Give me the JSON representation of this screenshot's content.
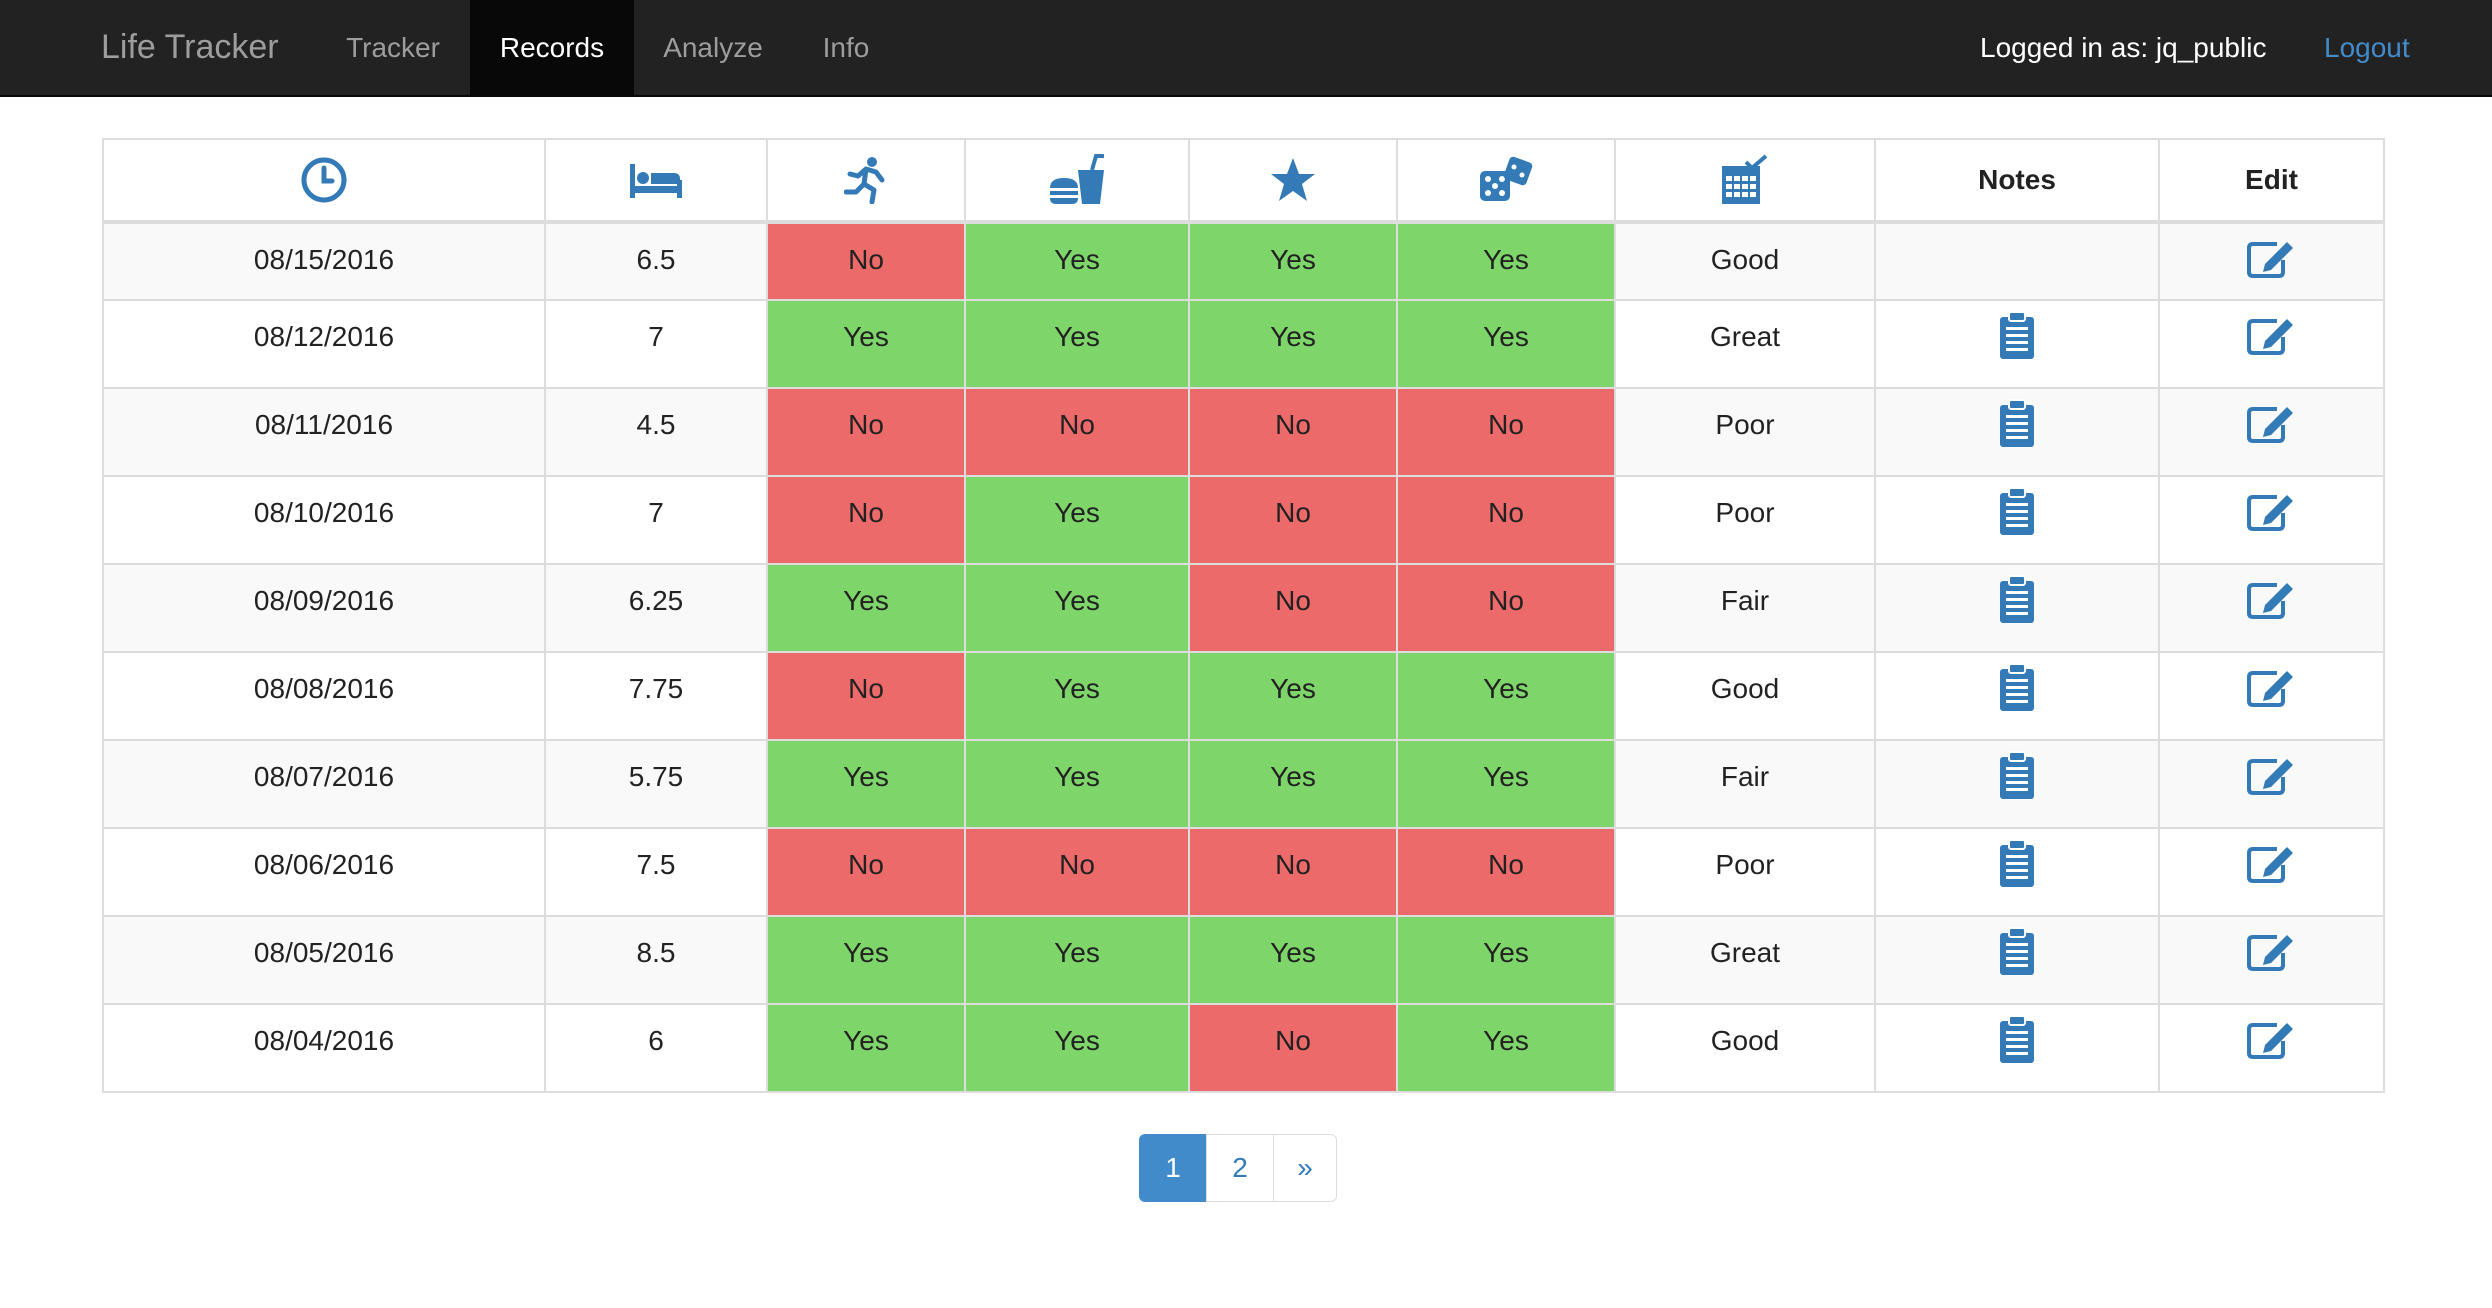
{
  "navbar": {
    "brand": "Life Tracker",
    "items": [
      {
        "label": "Tracker"
      },
      {
        "label": "Records"
      },
      {
        "label": "Analyze"
      },
      {
        "label": "Info"
      }
    ],
    "active": "Records",
    "logged_in": "Logged in as: jq_public",
    "logout": "Logout"
  },
  "table": {
    "header_icons": [
      "clock-icon",
      "bed-icon",
      "running-icon",
      "food-drink-icon",
      "star-icon",
      "dice-icon",
      "calendar-check-icon"
    ],
    "headers": {
      "notes": "Notes",
      "edit": "Edit"
    },
    "rows": [
      {
        "date": "08/15/2016",
        "sleep": "6.5",
        "exercise": "No",
        "diet": "Yes",
        "goal": "Yes",
        "fun": "Yes",
        "day": "Good",
        "has_notes": false
      },
      {
        "date": "08/12/2016",
        "sleep": "7",
        "exercise": "Yes",
        "diet": "Yes",
        "goal": "Yes",
        "fun": "Yes",
        "day": "Great",
        "has_notes": true
      },
      {
        "date": "08/11/2016",
        "sleep": "4.5",
        "exercise": "No",
        "diet": "No",
        "goal": "No",
        "fun": "No",
        "day": "Poor",
        "has_notes": true
      },
      {
        "date": "08/10/2016",
        "sleep": "7",
        "exercise": "No",
        "diet": "Yes",
        "goal": "No",
        "fun": "No",
        "day": "Poor",
        "has_notes": true
      },
      {
        "date": "08/09/2016",
        "sleep": "6.25",
        "exercise": "Yes",
        "diet": "Yes",
        "goal": "No",
        "fun": "No",
        "day": "Fair",
        "has_notes": true
      },
      {
        "date": "08/08/2016",
        "sleep": "7.75",
        "exercise": "No",
        "diet": "Yes",
        "goal": "Yes",
        "fun": "Yes",
        "day": "Good",
        "has_notes": true
      },
      {
        "date": "08/07/2016",
        "sleep": "5.75",
        "exercise": "Yes",
        "diet": "Yes",
        "goal": "Yes",
        "fun": "Yes",
        "day": "Fair",
        "has_notes": true
      },
      {
        "date": "08/06/2016",
        "sleep": "7.5",
        "exercise": "No",
        "diet": "No",
        "goal": "No",
        "fun": "No",
        "day": "Poor",
        "has_notes": true
      },
      {
        "date": "08/05/2016",
        "sleep": "8.5",
        "exercise": "Yes",
        "diet": "Yes",
        "goal": "Yes",
        "fun": "Yes",
        "day": "Great",
        "has_notes": true
      },
      {
        "date": "08/04/2016",
        "sleep": "6",
        "exercise": "Yes",
        "diet": "Yes",
        "goal": "No",
        "fun": "Yes",
        "day": "Good",
        "has_notes": true
      }
    ]
  },
  "pagination": {
    "pages": [
      "1",
      "2"
    ],
    "next": "»",
    "current": "1"
  },
  "colors": {
    "yes": "#7ed56a",
    "no": "#ec6a6a",
    "icon": "#337ab7",
    "navbar": "#222222"
  }
}
